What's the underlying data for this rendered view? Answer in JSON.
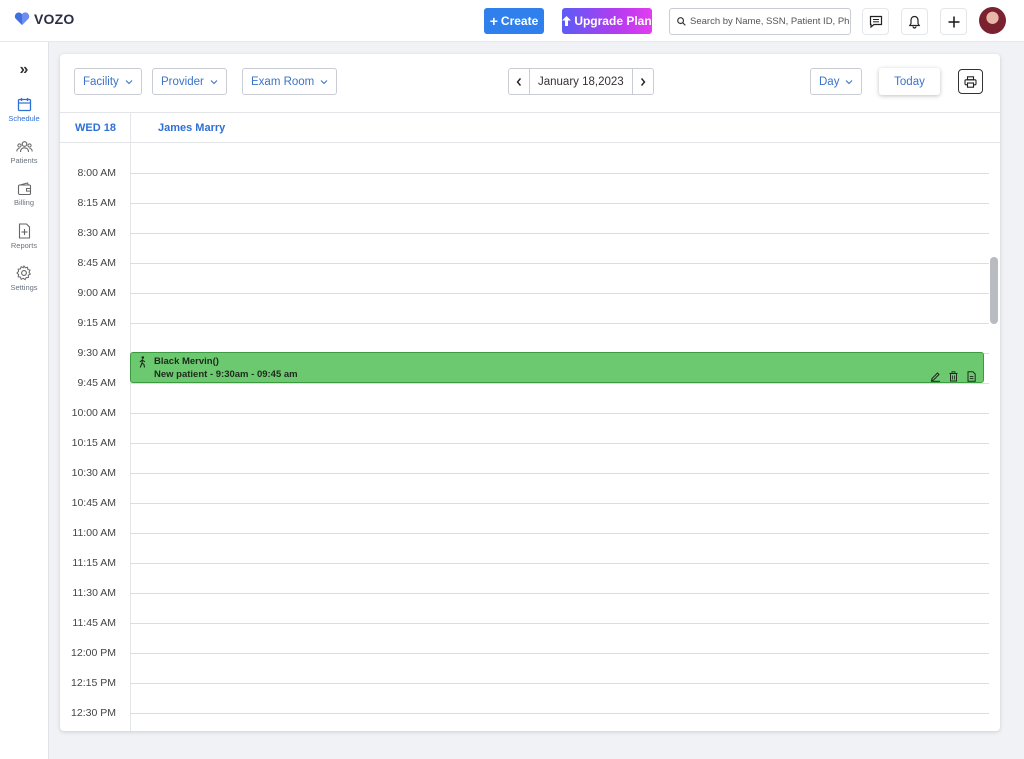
{
  "app": {
    "logo_text": "VOZO",
    "brand_color": "#2f80ed"
  },
  "header": {
    "create_label": "Create",
    "upgrade_label": "Upgrade Plan",
    "search_placeholder": "Search by Name, SSN, Patient ID, Phone"
  },
  "sidebar": {
    "items": [
      {
        "label": "Schedule",
        "icon": "calendar-icon",
        "active": true
      },
      {
        "label": "Patients",
        "icon": "patients-icon"
      },
      {
        "label": "Billing",
        "icon": "wallet-icon"
      },
      {
        "label": "Reports",
        "icon": "report-icon"
      },
      {
        "label": "Settings",
        "icon": "gear-icon"
      }
    ]
  },
  "toolbar": {
    "facility_label": "Facility",
    "provider_label": "Provider",
    "exam_room_label": "Exam Room",
    "date_label": "January 18,2023",
    "view_label": "Day",
    "today_label": "Today"
  },
  "calendar": {
    "day_label": "WED 18",
    "provider_name": "James Marry",
    "time_slots": [
      "8:00 AM",
      "8:15 AM",
      "8:30 AM",
      "8:45 AM",
      "9:00 AM",
      "9:15 AM",
      "9:30 AM",
      "9:45 AM",
      "10:00 AM",
      "10:15 AM",
      "10:30 AM",
      "10:45 AM",
      "11:00 AM",
      "11:15 AM",
      "11:30 AM",
      "11:45 AM",
      "12:00 PM",
      "12:15 PM",
      "12:30 PM"
    ],
    "appointment": {
      "patient": "Black Mervin()",
      "detail": "New patient - 9:30am - 09:45 am",
      "color": "#6cc970"
    }
  }
}
